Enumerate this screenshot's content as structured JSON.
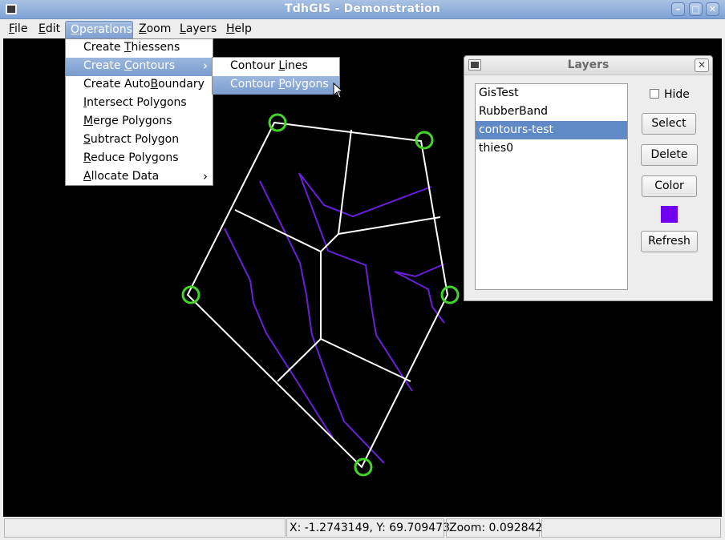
{
  "window": {
    "title": "TdhGIS - Demonstration",
    "controls": {
      "minimize": "–",
      "maximize": "□",
      "close": "✕"
    }
  },
  "menubar": {
    "items": [
      {
        "label": "File",
        "u": "F",
        "rest": "ile"
      },
      {
        "label": "Edit",
        "u": "E",
        "rest": "dit"
      },
      {
        "label": "Operations",
        "u": "O",
        "rest": "perations",
        "active": true
      },
      {
        "label": "Zoom",
        "u": "Z",
        "rest": "oom"
      },
      {
        "label": "Layers",
        "u": "L",
        "rest": "ayers"
      },
      {
        "label": "Help",
        "u": "H",
        "rest": "elp"
      }
    ]
  },
  "operations_menu": {
    "items": [
      {
        "label": "Create Thiessens",
        "pre": "Create ",
        "u": "T",
        "post": "hiessens",
        "submenu": false
      },
      {
        "label": "Create Contours",
        "pre": "Create ",
        "u": "C",
        "post": "ontours",
        "submenu": true,
        "highlighted": true
      },
      {
        "label": "Create AutoBoundary",
        "pre": "Create Auto",
        "u": "B",
        "post": "oundary",
        "submenu": false
      },
      {
        "label": "Intersect Polygons",
        "pre": "",
        "u": "I",
        "post": "ntersect Polygons",
        "submenu": false
      },
      {
        "label": "Merge Polygons",
        "pre": "",
        "u": "M",
        "post": "erge Polygons",
        "submenu": false
      },
      {
        "label": "Subtract Polygon",
        "pre": "",
        "u": "S",
        "post": "ubtract Polygon",
        "submenu": false
      },
      {
        "label": "Reduce Polygons",
        "pre": "",
        "u": "R",
        "post": "educe Polygons",
        "submenu": false
      },
      {
        "label": "Allocate Data",
        "pre": "",
        "u": "A",
        "post": "llocate Data",
        "submenu": true
      }
    ],
    "submenu_arrow": "›"
  },
  "contours_submenu": {
    "items": [
      {
        "label": "Contour Lines",
        "pre": "Contour ",
        "u": "L",
        "post": "ines"
      },
      {
        "label": "Contour Polygons",
        "pre": "Contour ",
        "u": "P",
        "post": "olygons",
        "highlighted": true
      }
    ]
  },
  "layers_window": {
    "title": "Layers",
    "close": "✕",
    "layers": [
      {
        "name": "GisTest",
        "selected": false
      },
      {
        "name": "RubberBand",
        "selected": false
      },
      {
        "name": "contours-test",
        "selected": true
      },
      {
        "name": "thies0",
        "selected": false
      }
    ],
    "hide_label": "Hide",
    "hide_checked": false,
    "buttons": {
      "select": "Select",
      "delete": "Delete",
      "color": "Color",
      "refresh": "Refresh"
    },
    "layer_color": "#7000f0"
  },
  "map": {
    "colors": {
      "background": "#000000",
      "boundary": "#ffffff",
      "contour": "#6a1fd8",
      "point": "#44d42a"
    }
  },
  "statusbar": {
    "message": "",
    "coords": "X: -1.2743149, Y: 69.709473",
    "zoom": "Zoom: 0.092842",
    "extra": ""
  }
}
